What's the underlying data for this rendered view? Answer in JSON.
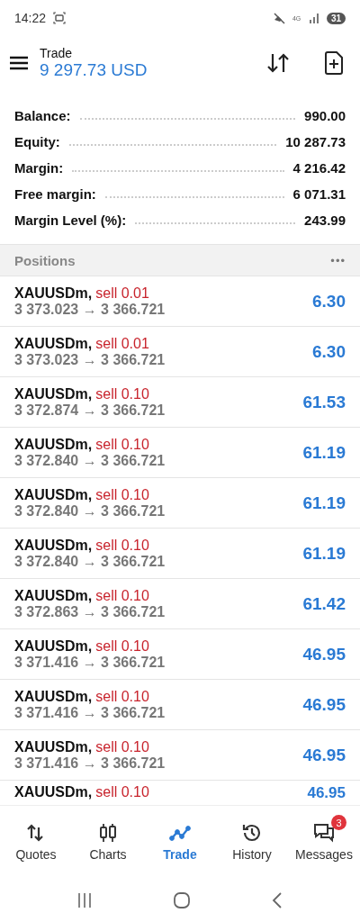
{
  "status_bar": {
    "time": "14:22",
    "network": "4G",
    "battery": "31"
  },
  "header": {
    "title": "Trade",
    "balance": "9 297.73 USD"
  },
  "summary": [
    {
      "label": "Balance:",
      "value": "990.00"
    },
    {
      "label": "Equity:",
      "value": "10 287.73"
    },
    {
      "label": "Margin:",
      "value": "4 216.42"
    },
    {
      "label": "Free margin:",
      "value": "6 071.31"
    },
    {
      "label": "Margin Level (%):",
      "value": "243.99"
    }
  ],
  "positions_header": {
    "title": "Positions",
    "more": "•••"
  },
  "positions": [
    {
      "symbol": "XAUUSDm,",
      "order": "sell 0.01",
      "prices": "3 373.023 → 3 366.721",
      "profit": "6.30"
    },
    {
      "symbol": "XAUUSDm,",
      "order": "sell 0.01",
      "prices": "3 373.023 → 3 366.721",
      "profit": "6.30"
    },
    {
      "symbol": "XAUUSDm,",
      "order": "sell 0.10",
      "prices": "3 372.874 → 3 366.721",
      "profit": "61.53"
    },
    {
      "symbol": "XAUUSDm,",
      "order": "sell 0.10",
      "prices": "3 372.840 → 3 366.721",
      "profit": "61.19"
    },
    {
      "symbol": "XAUUSDm,",
      "order": "sell 0.10",
      "prices": "3 372.840 → 3 366.721",
      "profit": "61.19"
    },
    {
      "symbol": "XAUUSDm,",
      "order": "sell 0.10",
      "prices": "3 372.840 → 3 366.721",
      "profit": "61.19"
    },
    {
      "symbol": "XAUUSDm,",
      "order": "sell 0.10",
      "prices": "3 372.863 → 3 366.721",
      "profit": "61.42"
    },
    {
      "symbol": "XAUUSDm,",
      "order": "sell 0.10",
      "prices": "3 371.416 → 3 366.721",
      "profit": "46.95"
    },
    {
      "symbol": "XAUUSDm,",
      "order": "sell 0.10",
      "prices": "3 371.416 → 3 366.721",
      "profit": "46.95"
    },
    {
      "symbol": "XAUUSDm,",
      "order": "sell 0.10",
      "prices": "3 371.416 → 3 366.721",
      "profit": "46.95"
    },
    {
      "symbol": "XAUUSDm,",
      "order": "sell 0.10",
      "profit": "46.95"
    }
  ],
  "bottom_nav": [
    {
      "kind": "quotes",
      "label": "Quotes",
      "selected": false
    },
    {
      "kind": "charts",
      "label": "Charts",
      "selected": false
    },
    {
      "kind": "trade",
      "label": "Trade",
      "selected": true
    },
    {
      "kind": "history",
      "label": "History",
      "selected": false
    },
    {
      "kind": "messages",
      "label": "Messages",
      "selected": false,
      "badge": "3"
    }
  ]
}
